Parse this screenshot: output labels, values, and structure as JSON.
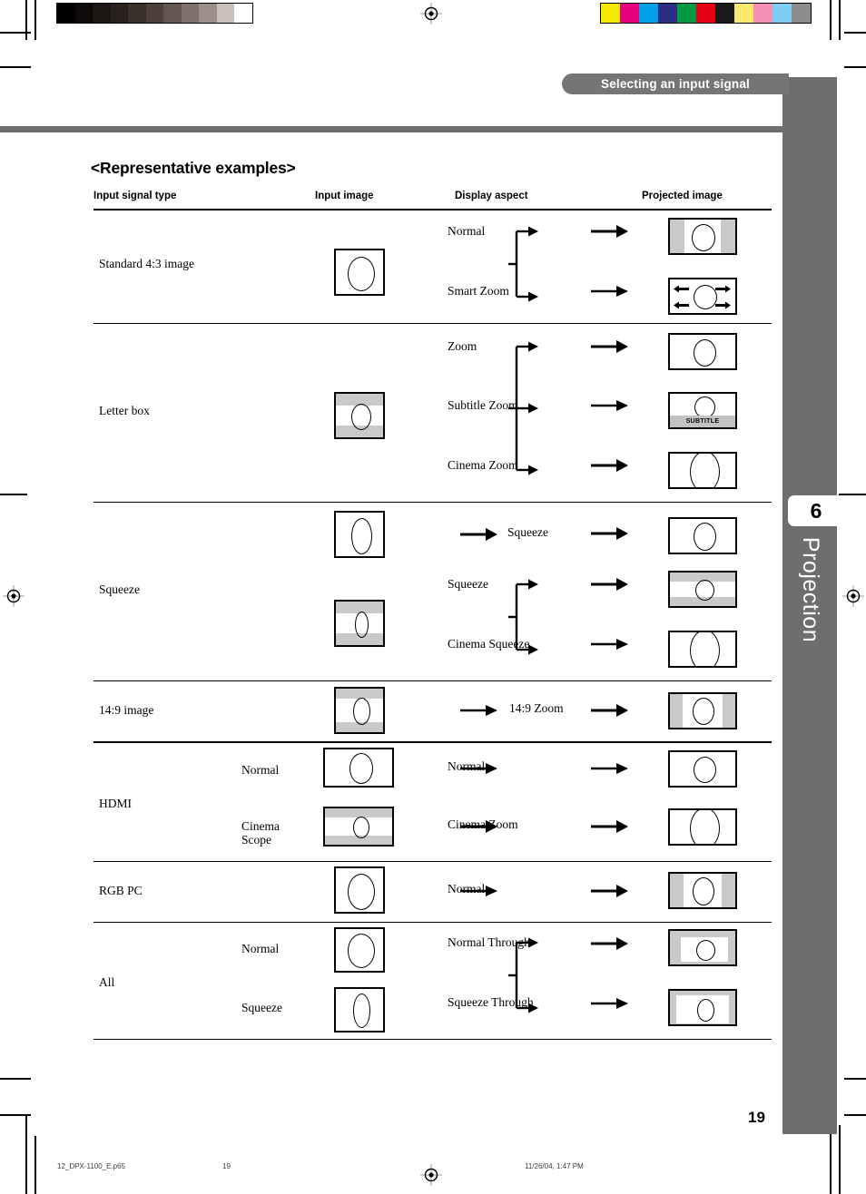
{
  "header": {
    "section_title": "Selecting an input signal",
    "chapter_number": "6",
    "chapter_name": "Projection"
  },
  "page": {
    "title": "<Representative examples>",
    "page_number": "19"
  },
  "table": {
    "columns": [
      "Input signal type",
      "Input image",
      "Display aspect",
      "Projected image"
    ],
    "rows": [
      {
        "signal_type": "Standard 4:3 image",
        "sub_labels": [],
        "aspects": [
          "Normal",
          "Smart Zoom"
        ]
      },
      {
        "signal_type": "Letter box",
        "sub_labels": [],
        "aspects": [
          "Zoom",
          "Subtitle Zoom",
          "Cinema Zoom"
        ]
      },
      {
        "signal_type": "Squeeze",
        "sub_labels": [],
        "aspects": [
          "Squeeze",
          "Squeeze",
          "Cinema Squeeze"
        ]
      },
      {
        "signal_type": "14:9 image",
        "sub_labels": [],
        "aspects": [
          "14:9 Zoom"
        ]
      },
      {
        "signal_type": "HDMI",
        "sub_labels": [
          "Normal",
          "Cinema\nScope"
        ],
        "aspects": [
          "Normal",
          "Cinema Zoom"
        ]
      },
      {
        "signal_type": "RGB PC",
        "sub_labels": [],
        "aspects": [
          "Normal"
        ]
      },
      {
        "signal_type": "All",
        "sub_labels": [
          "Normal",
          "Squeeze"
        ],
        "aspects": [
          "Normal Through",
          "Squeeze Through"
        ]
      }
    ],
    "subtitle_badge": "SUBTITLE"
  },
  "imprint": {
    "filename": "12_DPX-1100_E.p65",
    "folio": "19",
    "timestamp": "11/26/04, 1:47 PM"
  },
  "colors": {
    "sidebar": "#6e6e6e",
    "header_pill": "#757575",
    "letterbox_gray": "#c9c9c9",
    "grayscale_bar": [
      "#000000",
      "#0d0a09",
      "#1b1513",
      "#2a211e",
      "#3a2f2b",
      "#4d403b",
      "#64554f",
      "#80706a",
      "#9c8f8a",
      "#cbc0bc",
      "#ffffff"
    ],
    "color_bar": [
      "#f5ea00",
      "#e5007e",
      "#00a0e9",
      "#2b2e83",
      "#009944",
      "#e60012",
      "#1a1a1a",
      "#fbe96c",
      "#f48fb8",
      "#7ecef4",
      "#8c8c8c"
    ]
  }
}
